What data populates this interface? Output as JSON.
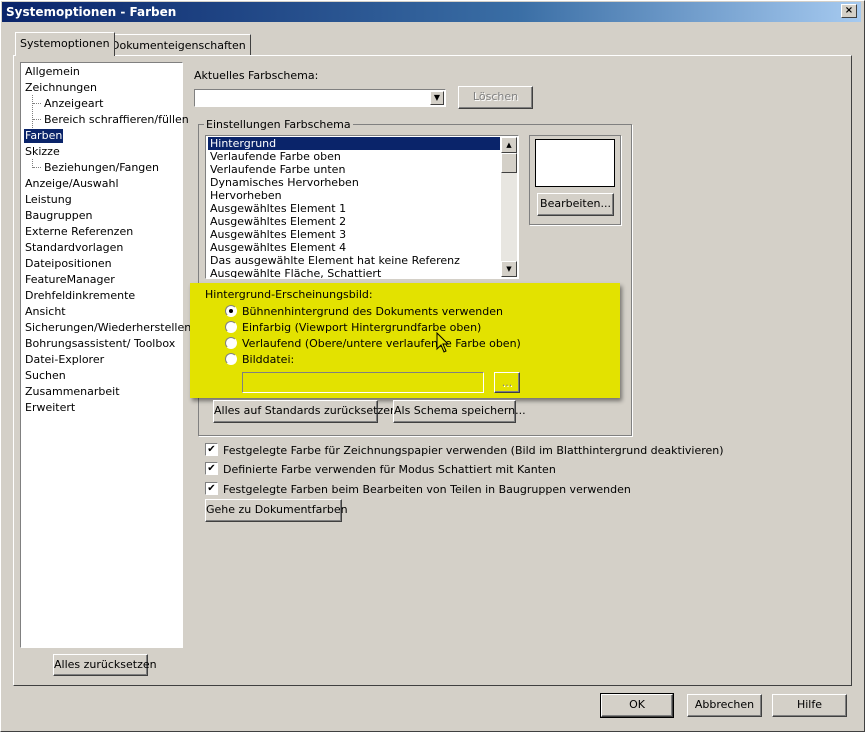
{
  "window": {
    "title": "Systemoptionen - Farben",
    "close_glyph": "×"
  },
  "tabs": [
    {
      "label": "Systemoptionen",
      "active": true
    },
    {
      "label": "Dokumenteigenschaften",
      "active": false
    }
  ],
  "tree": {
    "items": [
      {
        "label": "Allgemein",
        "indent": 0
      },
      {
        "label": "Zeichnungen",
        "indent": 0
      },
      {
        "label": "Anzeigeart",
        "indent": 1
      },
      {
        "label": "Bereich schraffieren/füllen",
        "indent": 1
      },
      {
        "label": "Farben",
        "indent": 0,
        "selected": true
      },
      {
        "label": "Skizze",
        "indent": 0
      },
      {
        "label": "Beziehungen/Fangen",
        "indent": 1
      },
      {
        "label": "Anzeige/Auswahl",
        "indent": 0
      },
      {
        "label": "Leistung",
        "indent": 0
      },
      {
        "label": "Baugruppen",
        "indent": 0
      },
      {
        "label": "Externe Referenzen",
        "indent": 0
      },
      {
        "label": "Standardvorlagen",
        "indent": 0
      },
      {
        "label": "Dateipositionen",
        "indent": 0
      },
      {
        "label": "FeatureManager",
        "indent": 0
      },
      {
        "label": "Drehfeldinkremente",
        "indent": 0
      },
      {
        "label": "Ansicht",
        "indent": 0
      },
      {
        "label": "Sicherungen/Wiederherstellen",
        "indent": 0
      },
      {
        "label": "Bohrungsassistent/ Toolbox",
        "indent": 0
      },
      {
        "label": "Datei-Explorer",
        "indent": 0
      },
      {
        "label": "Suchen",
        "indent": 0
      },
      {
        "label": "Zusammenarbeit",
        "indent": 0
      },
      {
        "label": "Erweitert",
        "indent": 0
      }
    ],
    "reset_all_label": "Alles zurücksetzen"
  },
  "scheme": {
    "label": "Aktuelles Farbschema:",
    "value": "",
    "delete_label": "Löschen"
  },
  "settings": {
    "group_label": "Einstellungen Farbschema",
    "items": [
      "Hintergrund",
      "Verlaufende Farbe oben",
      "Verlaufende Farbe unten",
      "Dynamisches Hervorheben",
      "Hervorheben",
      "Ausgewähltes Element 1",
      "Ausgewähltes Element 2",
      "Ausgewähltes Element 3",
      "Ausgewähltes Element 4",
      "Das ausgewählte Element hat keine Referenz",
      "Ausgewählte Fläche, Schattiert"
    ],
    "selected_index": 0,
    "edit_label": "Bearbeiten...",
    "preview_color": "#ffffff"
  },
  "background": {
    "label": "Hintergrund-Erscheinungsbild:",
    "options": [
      {
        "label": "Bühnenhintergrund des Dokuments verwenden",
        "selected": true
      },
      {
        "label": "Einfarbig (Viewport Hintergrundfarbe oben)",
        "selected": false
      },
      {
        "label": "Verlaufend (Obere/untere verlaufende Farbe oben)",
        "selected": false
      },
      {
        "label": "Bilddatei:",
        "selected": false
      }
    ],
    "file_value": "",
    "browse_label": "...",
    "highlight_color": "#e3e200"
  },
  "actions": {
    "reset_defaults_label": "Alles auf Standards zurücksetzen",
    "save_scheme_label": "Als Schema speichern..."
  },
  "checkboxes": [
    {
      "label": "Festgelegte Farbe für Zeichnungspapier verwenden (Bild im Blatthintergrund deaktivieren)",
      "checked": true
    },
    {
      "label": "Definierte Farbe verwenden für Modus Schattiert mit Kanten",
      "checked": true
    },
    {
      "label": "Festgelegte Farben beim Bearbeiten von Teilen in Baugruppen verwenden",
      "checked": true
    }
  ],
  "goto_doc_colors_label": "Gehe zu Dokumentfarben",
  "footer": {
    "ok": "OK",
    "cancel": "Abbrechen",
    "help": "Hilfe"
  },
  "glyphs": {
    "checkmark": "✔",
    "up": "▲",
    "down": "▼",
    "radio_on": "●"
  }
}
